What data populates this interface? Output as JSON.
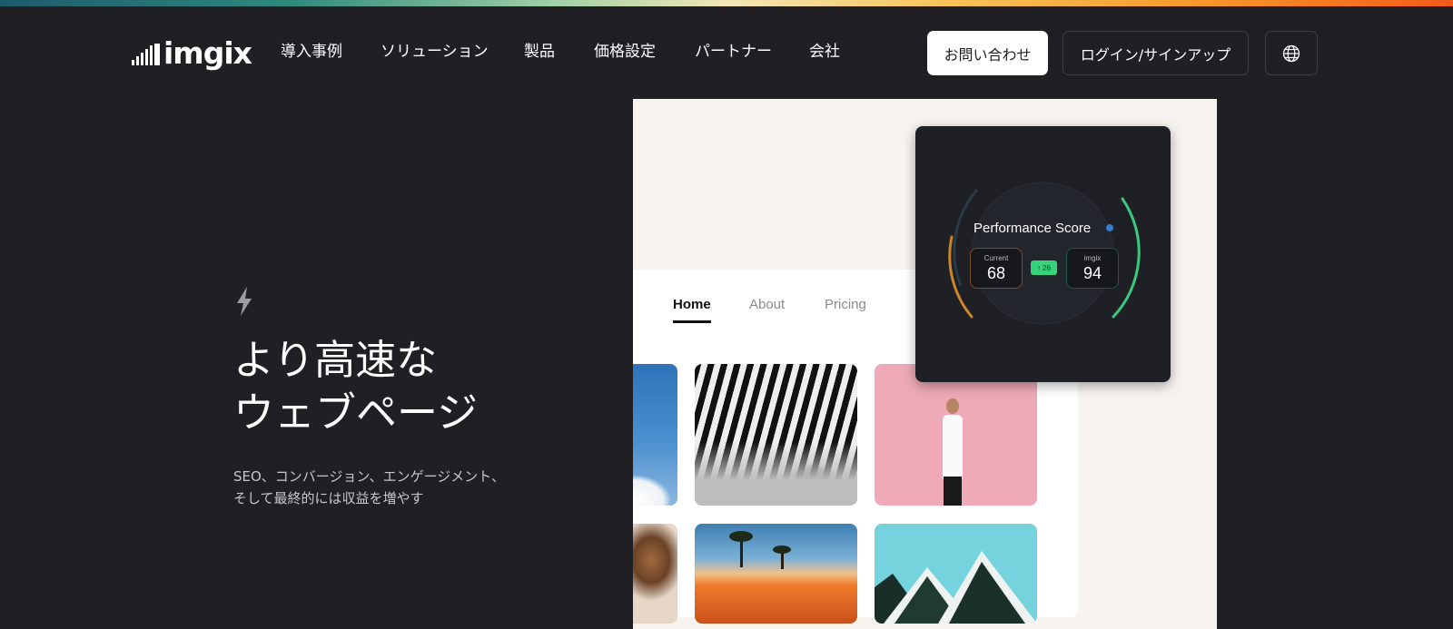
{
  "brand": {
    "name": "imgix"
  },
  "nav": {
    "items": [
      {
        "label": "導入事例"
      },
      {
        "label": "ソリューション"
      },
      {
        "label": "製品"
      },
      {
        "label": "価格設定"
      },
      {
        "label": "パートナー"
      },
      {
        "label": "会社"
      }
    ],
    "contact_label": "お問い合わせ",
    "login_label": "ログイン/サインアップ",
    "language_icon": "globe-icon"
  },
  "hero": {
    "icon": "lightning-bolt-icon",
    "title_line1": "より高速な",
    "title_line2": "ウェブページ",
    "subtitle": "SEO、コンバージョン、エンゲージメント、そして最終的には収益を増やす"
  },
  "mock_site": {
    "tabs": [
      {
        "label": "Home",
        "active": true
      },
      {
        "label": "About",
        "active": false
      },
      {
        "label": "Pricing",
        "active": false
      }
    ]
  },
  "performance": {
    "title": "Performance Score",
    "current_label": "Current",
    "current_value": "68",
    "imgix_label": "imgix",
    "imgix_value": "94",
    "delta": "26",
    "delta_icon": "arrow-up-icon",
    "current_color": "#e0902a",
    "imgix_color": "#3ddc8a"
  },
  "colors": {
    "background": "#1f1f24",
    "panel": "#f7f3ef",
    "accent_green": "#35d47a"
  }
}
